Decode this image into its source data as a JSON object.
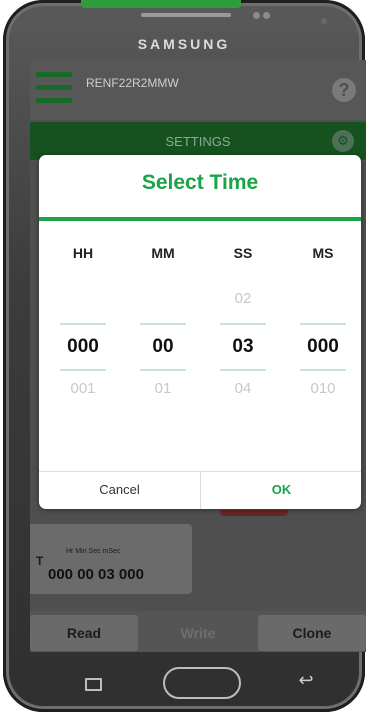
{
  "device": {
    "brand": "SAMSUNG",
    "nav_back_glyph": "↩",
    "icons": [
      "menu-key-icon",
      "home-key-icon",
      "back-key-icon"
    ]
  },
  "app": {
    "device_id": "RENF22R2MMW",
    "help_label": "?",
    "settings_title": "SETTINGS",
    "settings_icon": "gear-icon",
    "time_card": {
      "prefix": "T",
      "units": "Hr  Min  Sec  mSec",
      "value": "000 00 03 000"
    },
    "buttons": {
      "read": "Read",
      "write": "Write",
      "clone": "Clone"
    },
    "colors": {
      "header_green": "#16521f",
      "dim_overlay": "#4f4f4f"
    }
  },
  "dialog": {
    "title": "Select Time",
    "accent": "#1aa447",
    "columns": [
      {
        "header": "HH",
        "prev": "",
        "current": "000",
        "next": "001"
      },
      {
        "header": "MM",
        "prev": "",
        "current": "00",
        "next": "01"
      },
      {
        "header": "SS",
        "prev": "02",
        "current": "03",
        "next": "04"
      },
      {
        "header": "MS",
        "prev": "",
        "current": "000",
        "next": "010"
      }
    ],
    "cancel_label": "Cancel",
    "ok_label": "OK"
  }
}
